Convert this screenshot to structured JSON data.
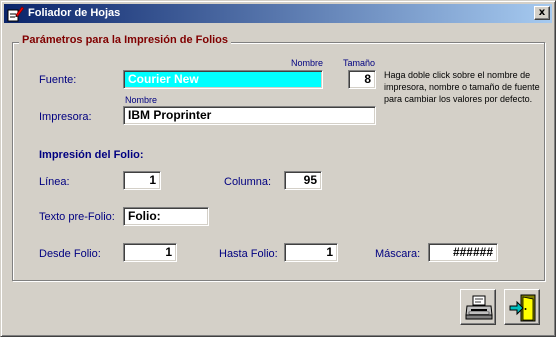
{
  "window": {
    "title": "Foliador de Hojas"
  },
  "group": {
    "legend": "Parámetros para la Impresión de Folios"
  },
  "fuente": {
    "label": "Fuente:",
    "value": "Courier New",
    "column_label": "Nombre"
  },
  "tamano": {
    "label": "Tamaño",
    "value": "8"
  },
  "impresora": {
    "label": "Impresora:",
    "value": "IBM Proprinter",
    "column_label": "Nombre"
  },
  "help_text": "Haga doble click sobre el nombre de impresora, nombre o tamaño de fuente para cambiar los valores por defecto.",
  "impresion": {
    "heading": "Impresión del Folio:",
    "linea": {
      "label": "Línea:",
      "value": "1"
    },
    "columna": {
      "label": "Columna:",
      "value": "95"
    },
    "texto_pre": {
      "label": "Texto pre-Folio:",
      "value": "Folio:"
    },
    "desde": {
      "label": "Desde Folio:",
      "value": "1"
    },
    "hasta": {
      "label": "Hasta Folio:",
      "value": "1"
    },
    "mascara": {
      "label": "Máscara:",
      "value": "######"
    }
  },
  "icons": {
    "app": "pencil-document-icon",
    "print": "printer-icon",
    "exit": "exit-door-icon",
    "close": "close-icon"
  },
  "buttons": {
    "close_glyph": "x"
  }
}
